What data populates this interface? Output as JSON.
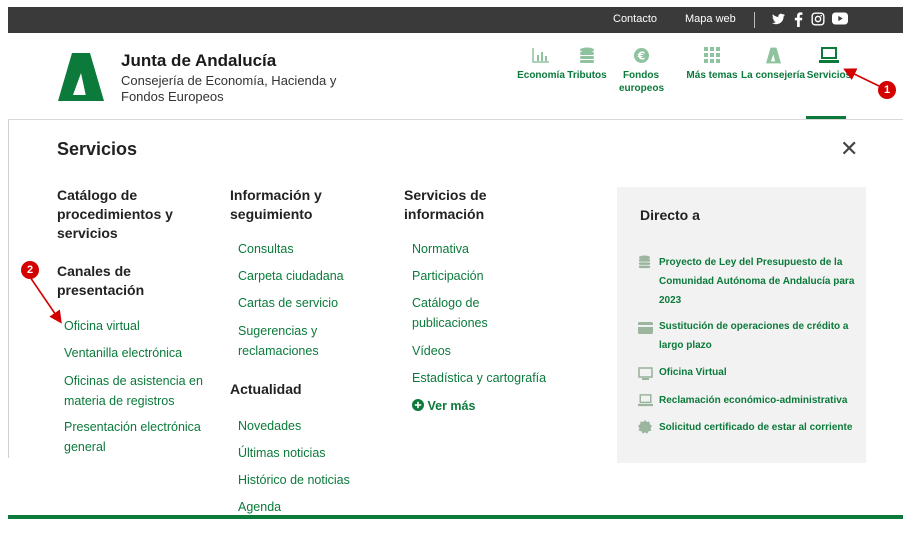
{
  "topbar": {
    "contact": "Contacto",
    "sitemap": "Mapa web",
    "social": [
      "twitter-icon",
      "facebook-icon",
      "instagram-icon",
      "youtube-icon"
    ]
  },
  "brand": {
    "title": "Junta de Andalucía",
    "subtitle": "Consejería de Economía, Hacienda y Fondos Europeos"
  },
  "topnav": [
    {
      "label": "Economía",
      "icon": "chart-icon"
    },
    {
      "label": "Tributos",
      "icon": "coins-icon"
    },
    {
      "label": "Fondos europeos",
      "icon": "euro-icon"
    },
    {
      "label": "Más temas",
      "icon": "grid-icon"
    },
    {
      "label": "La consejería",
      "icon": "andalucia-logo-icon"
    },
    {
      "label": "Servicios",
      "icon": "laptop-icon",
      "active": true
    }
  ],
  "panel": {
    "title": "Servicios",
    "close": "✕"
  },
  "col1": {
    "heading1": "Catálogo de procedimientos y servicios",
    "heading2": "Canales de presentación",
    "links": [
      "Oficina virtual",
      "Ventanilla electrónica",
      "Oficinas de asistencia en materia de registros",
      "Presentación electrónica general"
    ]
  },
  "col2": {
    "heading1": "Información y seguimiento",
    "links1": [
      "Consultas",
      "Carpeta ciudadana",
      "Cartas de servicio",
      "Sugerencias y reclamaciones"
    ],
    "heading2": "Actualidad",
    "links2": [
      "Novedades",
      "Últimas noticias",
      "Histórico de noticias",
      "Agenda"
    ]
  },
  "col3": {
    "heading": "Servicios de información",
    "links": [
      "Normativa",
      "Participación",
      "Catálogo de publicaciones",
      "Vídeos",
      "Estadística y cartografía"
    ],
    "more": "Ver más"
  },
  "direct": {
    "title": "Directo a",
    "links": [
      {
        "label": "Proyecto de Ley del Presupuesto de la Comunidad Autónoma de Andalucía para 2023",
        "icon": "coins-icon"
      },
      {
        "label": "Sustitución de operaciones de crédito a largo plazo",
        "icon": "card-icon"
      },
      {
        "label": "Oficina Virtual",
        "icon": "monitor-icon"
      },
      {
        "label": "Reclamación económico-administrativa",
        "icon": "laptop-icon"
      },
      {
        "label": "Solicitud certificado de estar al corriente",
        "icon": "badge-icon"
      }
    ]
  },
  "annotations": {
    "marker1": "1",
    "marker2": "2",
    "color": "#d40000"
  },
  "colors": {
    "brand_green": "#0b7a3b",
    "topbar": "#3a3a3a",
    "direct_bg": "#f2f2f2"
  }
}
